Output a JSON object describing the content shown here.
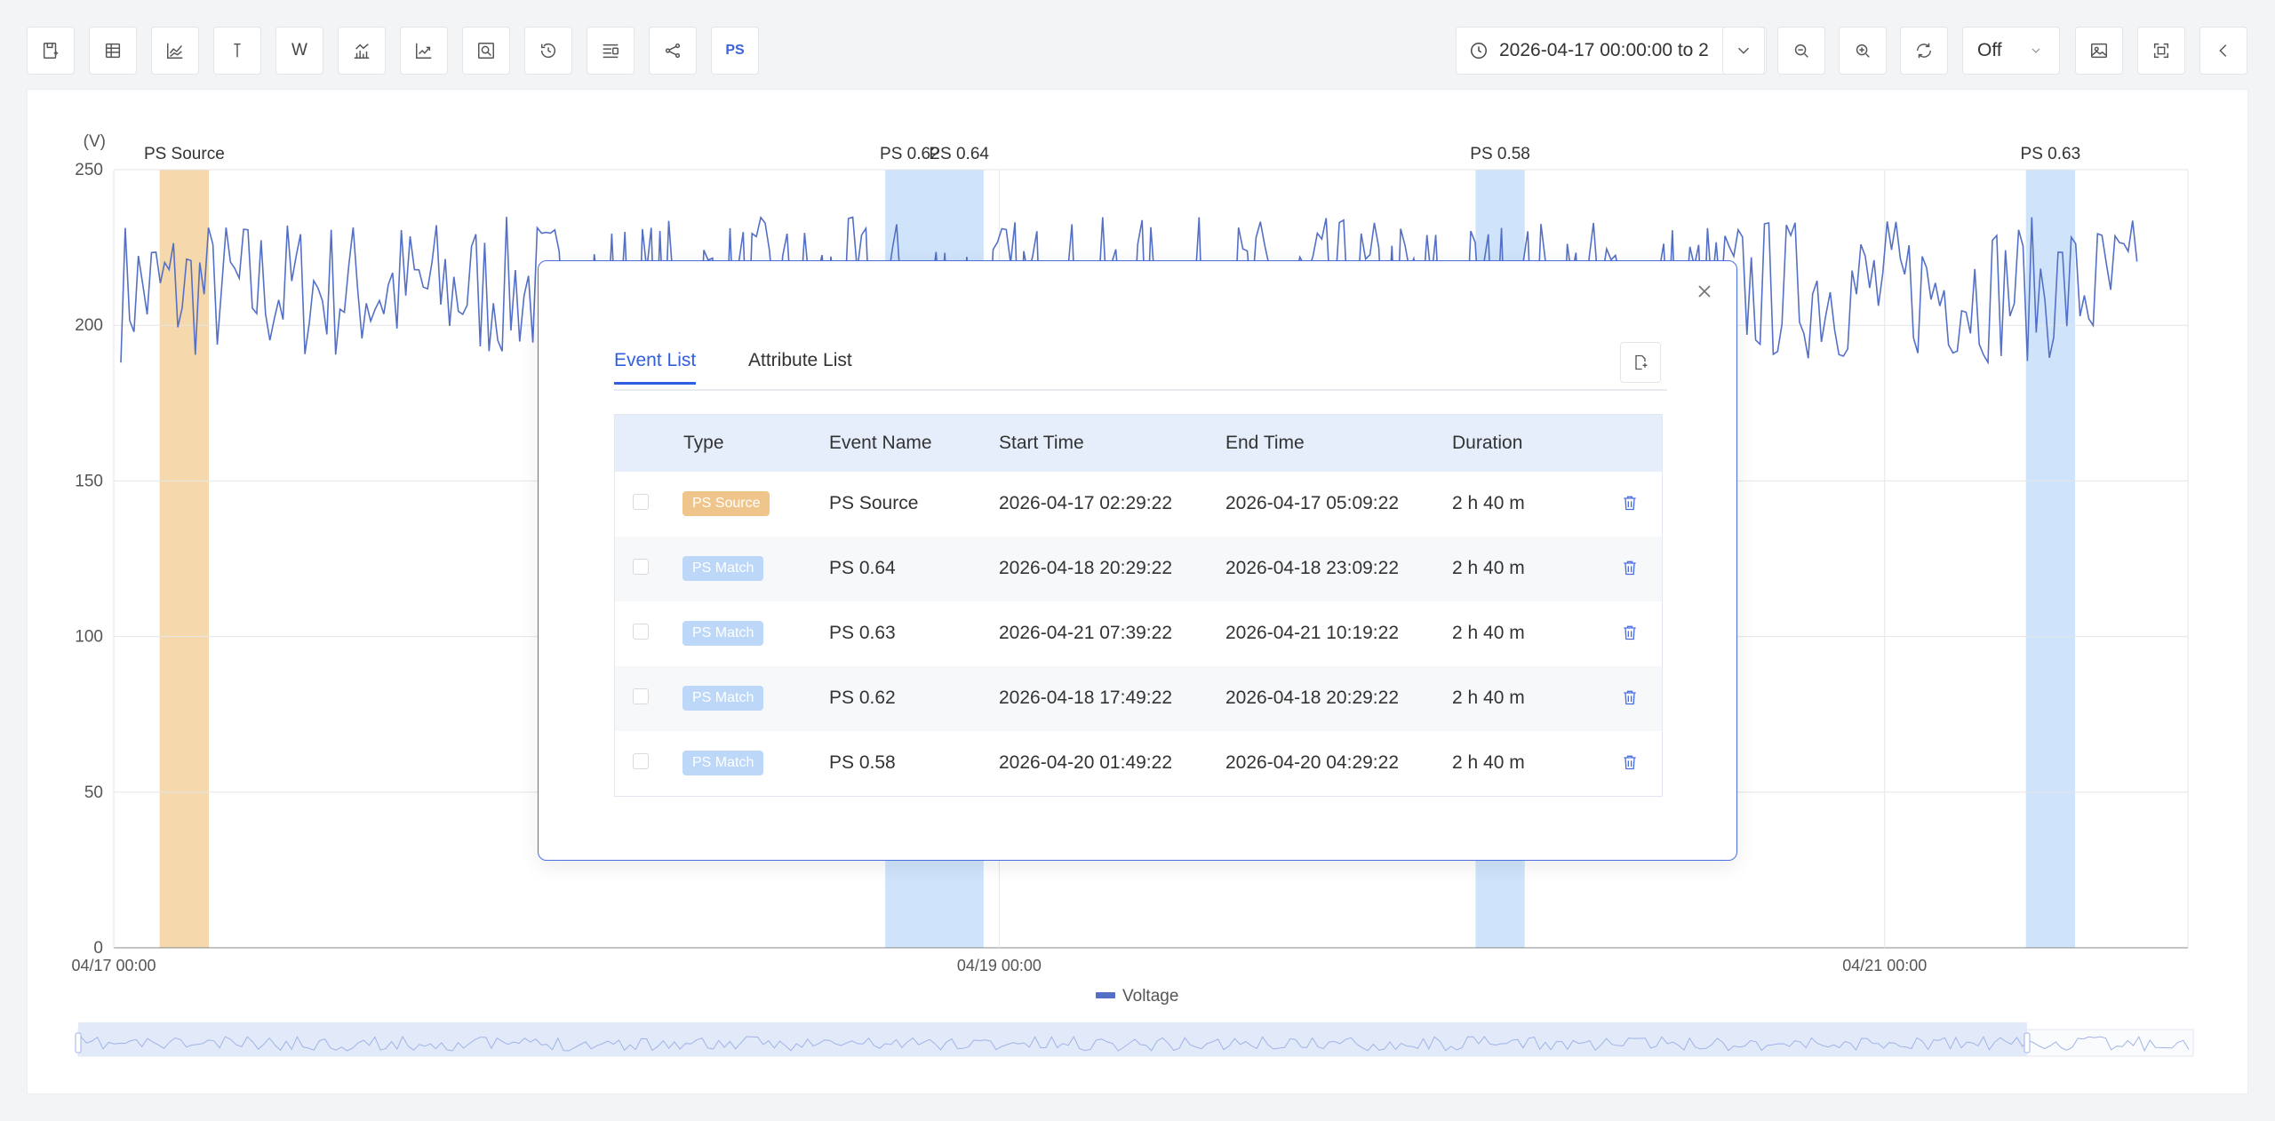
{
  "toolbar": {
    "left_buttons": [
      {
        "icon": "save-icon"
      },
      {
        "icon": "table-icon"
      },
      {
        "icon": "line-chart-icon"
      },
      {
        "icon": "cursor-t-icon"
      },
      {
        "icon": "w-text-icon",
        "text": "W"
      },
      {
        "icon": "bar-line-chart-icon"
      },
      {
        "icon": "trend-chart-icon"
      },
      {
        "icon": "zoom-box-icon"
      },
      {
        "icon": "history-icon"
      },
      {
        "icon": "list-settings-icon"
      },
      {
        "icon": "share-icon"
      },
      {
        "icon": "ps-icon",
        "text": "PS"
      }
    ],
    "date_range": "2026-04-17 00:00:00 to 2",
    "refresh_option": "Off"
  },
  "chart_data": {
    "type": "line",
    "ylabel": "(V)",
    "ylim": [
      0,
      250
    ],
    "yticks": [
      "0",
      "50",
      "100",
      "150",
      "200",
      "250"
    ],
    "x_range": [
      "2026-04-17 00:00",
      "2026-04-21 23:59"
    ],
    "xticks": [
      "04/17 00:00",
      "04/19 00:00",
      "04/21 00:00"
    ],
    "legend": {
      "position": "bottom",
      "entries": [
        "Voltage"
      ]
    },
    "series": [
      {
        "name": "Voltage",
        "color": "#5470c6",
        "y_range": [
          188,
          235
        ],
        "mean": 210
      }
    ],
    "bands": [
      {
        "label": "PS Source",
        "start": "2026-04-17 02:29:22",
        "end": "2026-04-17 05:09:22",
        "color": "#f5d8ab"
      },
      {
        "label": "PS 0.62",
        "start": "2026-04-18 17:49:22",
        "end": "2026-04-18 20:29:22",
        "color": "#cfe4fb"
      },
      {
        "label": "PS 0.64",
        "start": "2026-04-18 20:29:22",
        "end": "2026-04-18 23:09:22",
        "color": "#cfe4fb"
      },
      {
        "label": "PS 0.58",
        "start": "2026-04-20 01:49:22",
        "end": "2026-04-20 04:29:22",
        "color": "#cfe4fb"
      },
      {
        "label": "PS 0.63",
        "start": "2026-04-21 07:39:22",
        "end": "2026-04-21 10:19:22",
        "color": "#cfe4fb"
      }
    ],
    "grid": true
  },
  "modal": {
    "tabs": [
      "Event List",
      "Attribute List"
    ],
    "active_tab": "Event List",
    "columns": [
      "Type",
      "Event Name",
      "Start Time",
      "End Time",
      "Duration"
    ],
    "rows": [
      {
        "type": "PS Source",
        "type_color": "#f0c58c",
        "name": "PS Source",
        "start": "2026-04-17 02:29:22",
        "end": "2026-04-17 05:09:22",
        "duration": "2 h 40 m"
      },
      {
        "type": "PS Match",
        "type_color": "#bcd7f7",
        "name": "PS 0.64",
        "start": "2026-04-18 20:29:22",
        "end": "2026-04-18 23:09:22",
        "duration": "2 h 40 m"
      },
      {
        "type": "PS Match",
        "type_color": "#bcd7f7",
        "name": "PS 0.63",
        "start": "2026-04-21 07:39:22",
        "end": "2026-04-21 10:19:22",
        "duration": "2 h 40 m"
      },
      {
        "type": "PS Match",
        "type_color": "#bcd7f7",
        "name": "PS 0.62",
        "start": "2026-04-18 17:49:22",
        "end": "2026-04-18 20:29:22",
        "duration": "2 h 40 m"
      },
      {
        "type": "PS Match",
        "type_color": "#bcd7f7",
        "name": "PS 0.58",
        "start": "2026-04-20 01:49:22",
        "end": "2026-04-20 04:29:22",
        "duration": "2 h 40 m"
      }
    ]
  }
}
